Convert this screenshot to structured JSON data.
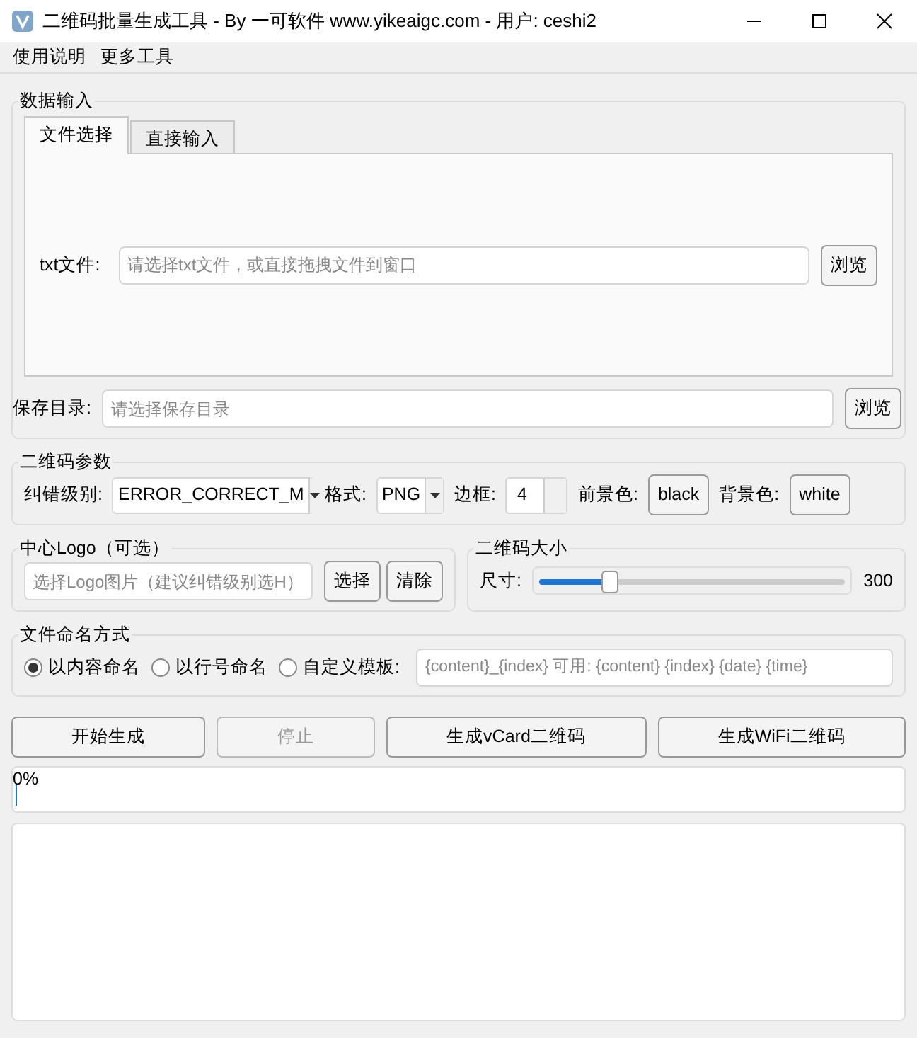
{
  "window": {
    "title": "二维码批量生成工具 - By 一可软件 www.yikeaigc.com - 用户: ceshi2"
  },
  "menu": [
    "使用说明",
    "更多工具"
  ],
  "data_input": {
    "title": "数据输入",
    "tabs": [
      {
        "label": "文件选择",
        "selected": true
      },
      {
        "label": "直接输入",
        "selected": false
      }
    ],
    "txt_label": "txt文件:",
    "txt_placeholder": "请选择txt文件，或直接拖拽文件到窗口",
    "txt_button": "浏览",
    "save_label": "保存目录:",
    "save_placeholder": "请选择保存目录",
    "save_button": "浏览"
  },
  "params": {
    "title": "二维码参数",
    "ec_label": "纠错级别:",
    "ec_value": "ERROR_CORRECT_M",
    "format_label": "格式:",
    "format_value": "PNG",
    "border_label": "边框:",
    "border_value": "4",
    "fg_label": "前景色:",
    "fg_button": "black",
    "bg_label": "背景色:",
    "bg_button": "white"
  },
  "logo": {
    "title": "中心Logo（可选）",
    "placeholder": "选择Logo图片（建议纠错级别选H）",
    "choose_button": "选择",
    "clear_button": "清除"
  },
  "size": {
    "title": "二维码大小",
    "label": "尺寸:",
    "level": 0.23,
    "reading": "300"
  },
  "naming": {
    "title": "文件命名方式",
    "options": [
      {
        "label": "以内容命名",
        "selected": true
      },
      {
        "label": "以行号命名",
        "selected": false
      },
      {
        "label": "自定义模板:",
        "selected": false
      }
    ],
    "template_placeholder": "{content}_{index}  可用: {content} {index} {date} {time}"
  },
  "actions": [
    {
      "label": "开始生成",
      "disabled": false
    },
    {
      "label": "停止",
      "disabled": true
    },
    {
      "label": "生成vCard二维码",
      "disabled": false
    },
    {
      "label": "生成WiFi二维码",
      "disabled": false
    }
  ],
  "progress": {
    "level": 0,
    "reading": "0%"
  }
}
